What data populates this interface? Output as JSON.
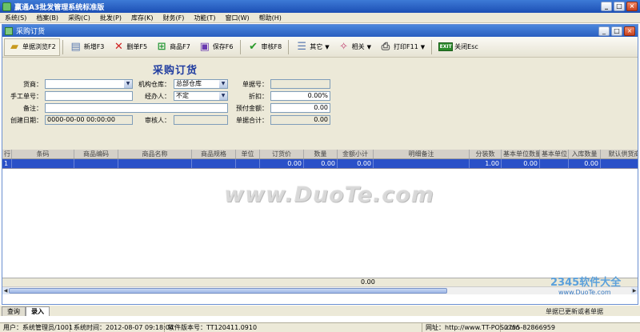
{
  "app": {
    "title": "赢通A3批发管理系统标准版"
  },
  "menu": [
    "系统(S)",
    "档案(B)",
    "采购(C)",
    "批发(P)",
    "库存(K)",
    "财务(F)",
    "功能(T)",
    "窗口(W)",
    "帮助(H)"
  ],
  "child_window": {
    "title": "采购订货"
  },
  "toolbar": {
    "browse": "单据浏览F2",
    "add": "新增F3",
    "delete": "删单F5",
    "product": "商品F7",
    "save": "保存F6",
    "audit": "审核F8",
    "other": "其它",
    "related": "相关",
    "print": "打印F11",
    "close": "关闭Esc",
    "exit_badge": "EXIT"
  },
  "form": {
    "title": "采购订货",
    "supplier_label": "货商：",
    "supplier_value": "",
    "warehouse_label": "机构仓库：",
    "warehouse_value": "总部仓库",
    "doc_no_label": "单据号：",
    "doc_no_value": "",
    "manual_no_label": "手工单号：",
    "manual_no_value": "",
    "handler_label": "经办人：",
    "handler_value": "不定",
    "discount_label": "折扣：",
    "discount_value": "0.00%",
    "remark_label": "备注：",
    "remark_value": "",
    "prepay_label": "预付金额：",
    "prepay_value": "0.00",
    "created_label": "创建日期：",
    "created_value": "0000-00-00 00:00:00",
    "auditor_label": "审核人：",
    "auditor_value": "",
    "total_label": "单据合计：",
    "total_value": "0.00"
  },
  "grid": {
    "columns": [
      "行",
      "条码",
      "商品编码",
      "商品名称",
      "商品规格",
      "单位",
      "订货价",
      "数量",
      "金额小计",
      "明细备注",
      "分装数",
      "基本单位数量",
      "基本单位",
      "入库数量",
      "默认供货商"
    ],
    "rows": [
      [
        "1",
        "",
        "",
        "",
        "",
        "",
        "0.00",
        "0.00",
        "0.00",
        "",
        "1.00",
        "0.00",
        "",
        "0.00",
        ""
      ]
    ],
    "footer_total": "0.00"
  },
  "tabs": [
    "查询",
    "录入"
  ],
  "hint": "单据已更新或者单据",
  "status": {
    "user": "用户：系统管理员/1001",
    "time": "系统时间：2012-08-07 09:18:04",
    "version": "软件版本号：TT120411.0910",
    "website": "网址：http://www.TT-POS.com",
    "phone": "0755-82866959"
  },
  "watermark": "www.DuoTe.com",
  "brand": {
    "name": "2345软件大全",
    "url": "www.DuoTe.com"
  }
}
